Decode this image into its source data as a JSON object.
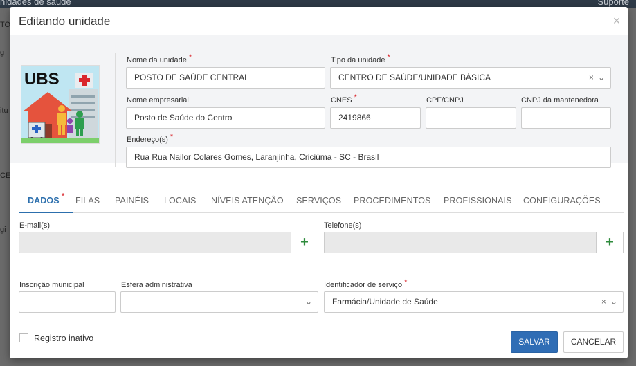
{
  "background": {
    "top_left_text": "nidades de saude",
    "top_right_text": "Suporte",
    "fragments": [
      "TO",
      "g",
      "itu",
      "CE",
      "gi"
    ]
  },
  "modal": {
    "title": "Editando unidade",
    "close_icon": "close-icon"
  },
  "unit": {
    "logo_text": "UBS",
    "name_label": "Nome da unidade",
    "name_value": "POSTO DE SAÚDE CENTRAL",
    "type_label": "Tipo da unidade",
    "type_value": "CENTRO DE SAÚDE/UNIDADE BÁSICA",
    "company_label": "Nome empresarial",
    "company_value": "Posto de Saúde do Centro",
    "cnes_label": "CNES",
    "cnes_value": "2419866",
    "cpf_label": "CPF/CNPJ",
    "cpf_value": "",
    "cnpj_label": "CNPJ da mantenedora",
    "cnpj_value": "",
    "address_label": "Endereço(s)",
    "address_value": "Rua Rua Nailor Colares Gomes, Laranjinha, Criciúma - SC - Brasil"
  },
  "tabs": [
    "DADOS",
    "FILAS",
    "PAINÉIS",
    "LOCAIS",
    "NÍVEIS ATENÇÃO",
    "SERVIÇOS",
    "PROCEDIMENTOS",
    "PROFISSIONAIS",
    "CONFIGURAÇÕES"
  ],
  "dados": {
    "email_label": "E-mail(s)",
    "email_value": "",
    "phone_label": "Telefone(s)",
    "phone_value": "",
    "add_symbol": "+",
    "municipal_label": "Inscrição municipal",
    "municipal_value": "",
    "sphere_label": "Esfera administrativa",
    "sphere_value": "",
    "service_id_label": "Identificador de serviço",
    "service_id_value": "Farmácia/Unidade de Saúde"
  },
  "footer": {
    "inactive_label": "Registro inativo",
    "save_label": "SALVAR",
    "cancel_label": "CANCELAR"
  },
  "colors": {
    "primary": "#2f6db5",
    "required": "#d9262c",
    "add_green": "#2e8b3c",
    "tab_active": "#2c6fad"
  },
  "required_mark": "*",
  "select_clear": "×",
  "select_caret": "⌄"
}
